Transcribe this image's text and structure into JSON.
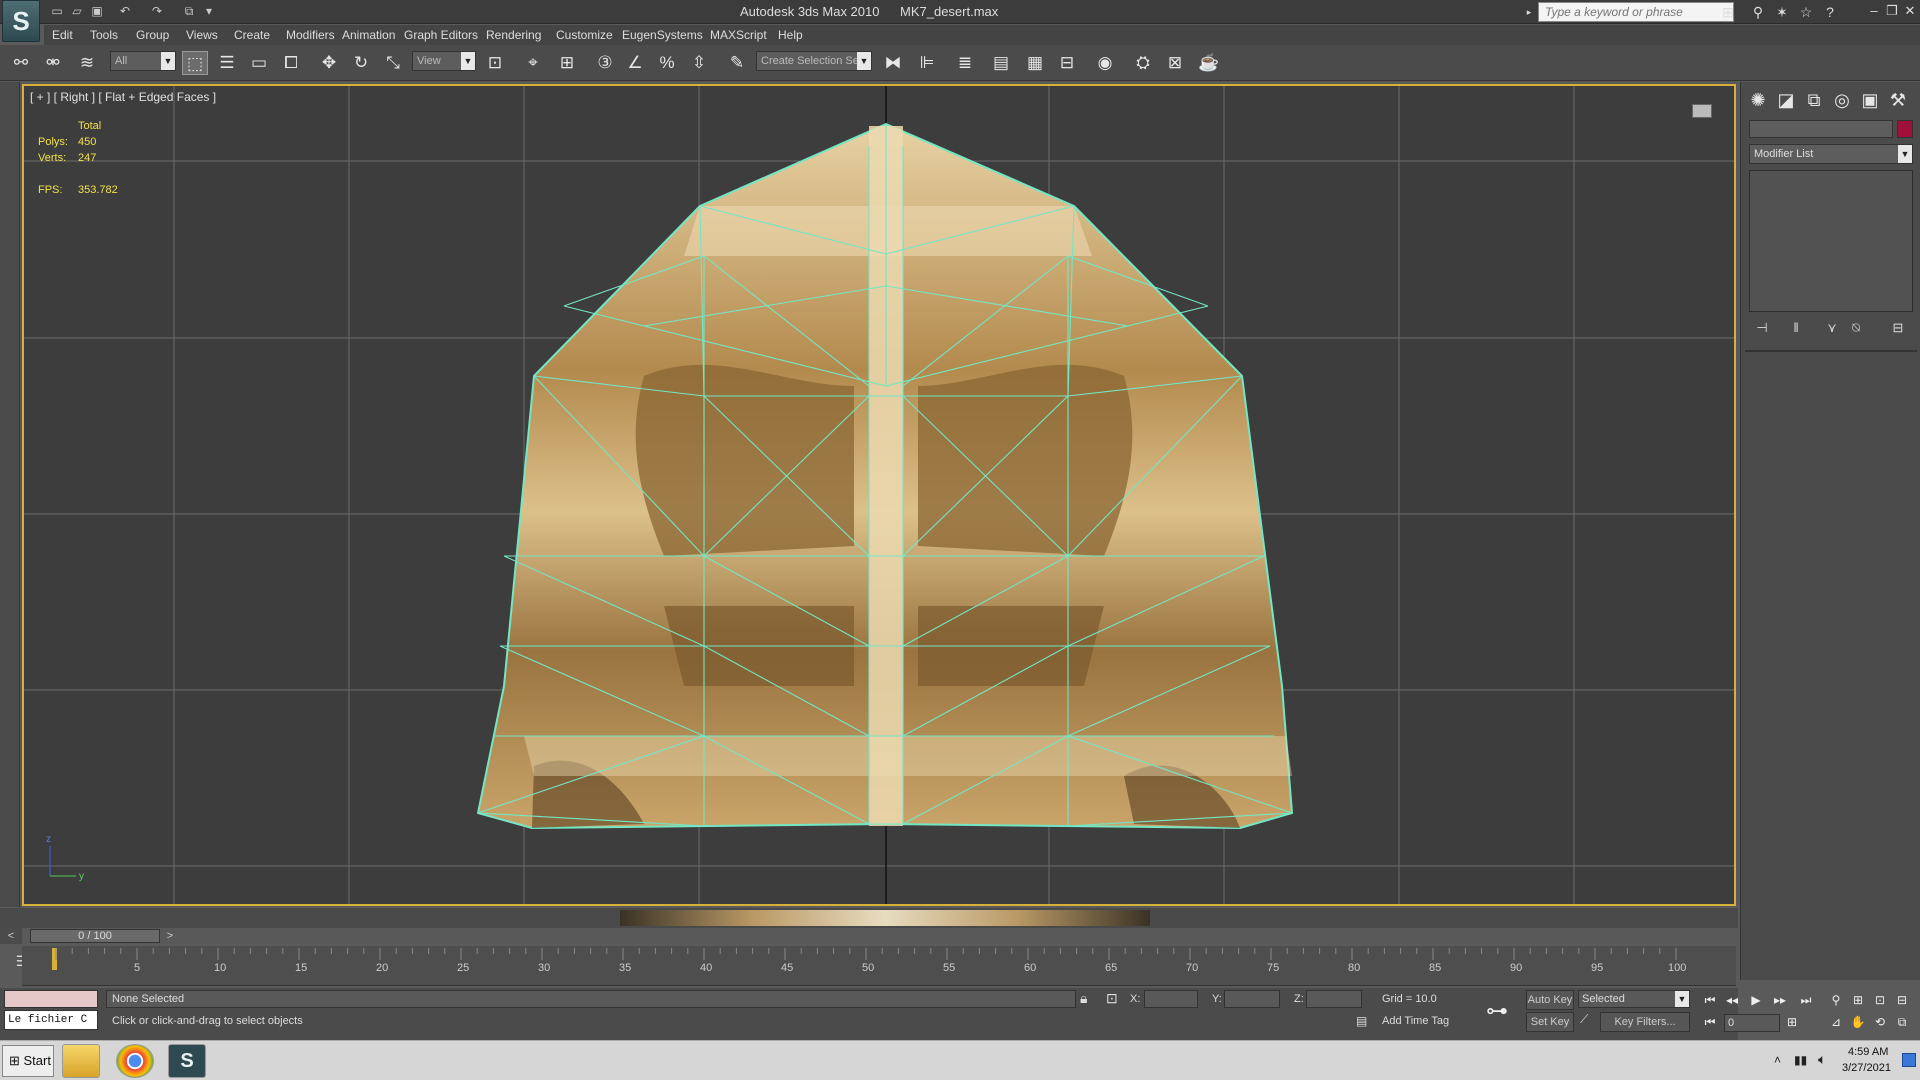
{
  "titlebar": {
    "app_title": "Autodesk 3ds Max  2010",
    "file_title": "MK7_desert.max",
    "search_placeholder": "Type a keyword or phrase",
    "logo_glyph": "S"
  },
  "menu": [
    "Edit",
    "Tools",
    "Group",
    "Views",
    "Create",
    "Modifiers",
    "Animation",
    "Graph Editors",
    "Rendering",
    "Customize",
    "EugenSystems",
    "MAXScript",
    "Help"
  ],
  "toolbar": {
    "selection_filter": "All",
    "ref_coord": "View",
    "named_selection": "Create Selection Se"
  },
  "viewport": {
    "label": "[ + ] [ Right ] [ Flat + Edged Faces ]",
    "stats": {
      "total_label": "Total",
      "polys_label": "Polys:",
      "polys_value": "450",
      "verts_label": "Verts:",
      "verts_value": "247",
      "fps_label": "FPS:",
      "fps_value": "353.782"
    },
    "axis_z": "z",
    "axis_y": "y",
    "mesh_color": "#c9a56a",
    "edge_color": "#74e6c4"
  },
  "right_panel": {
    "modifier_list": "Modifier List",
    "object_color": "#a0103a"
  },
  "timeline": {
    "slider_label": "0 / 100",
    "ticks": [
      "5",
      "10",
      "15",
      "20",
      "25",
      "30",
      "35",
      "40",
      "45",
      "50",
      "55",
      "60",
      "65",
      "70",
      "75",
      "80",
      "85",
      "90",
      "95",
      "100"
    ]
  },
  "status": {
    "maxscript_text": "Le fichier C",
    "selection": "None Selected",
    "prompt": "Click or click-and-drag to select objects",
    "x_label": "X:",
    "y_label": "Y:",
    "z_label": "Z:",
    "grid": "Grid = 10.0",
    "add_time_tag": "Add Time Tag",
    "auto_key": "Auto Key",
    "selected": "Selected",
    "set_key": "Set Key",
    "key_filters": "Key Filters...",
    "frame": "0"
  },
  "taskbar": {
    "start": "Start",
    "time": "4:59 AM",
    "date": "3/27/2021"
  }
}
